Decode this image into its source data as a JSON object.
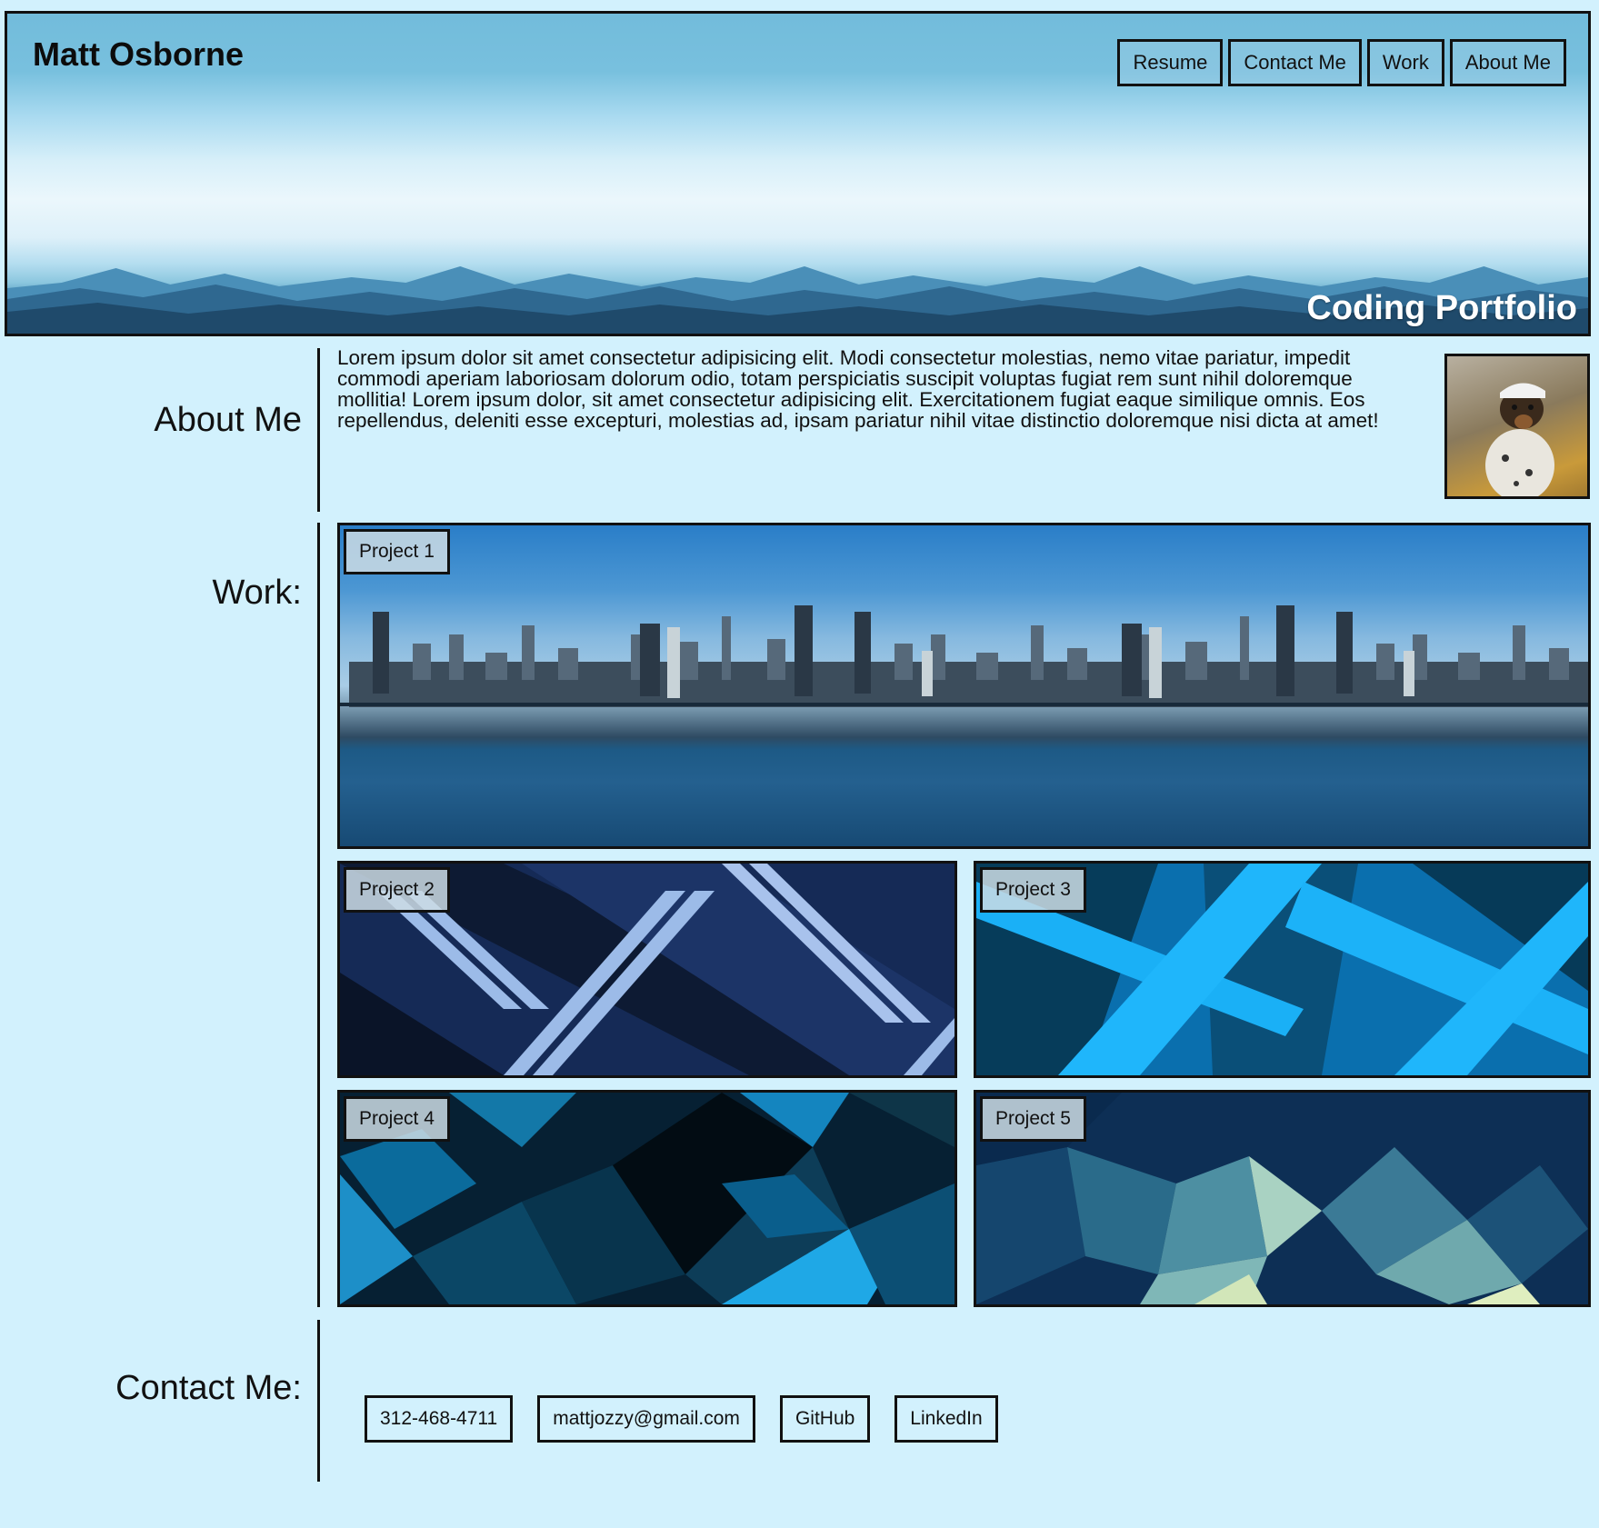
{
  "header": {
    "name": "Matt Osborne",
    "nav": [
      "Resume",
      "Contact Me",
      "Work",
      "About Me"
    ],
    "tagline": "Coding Portfolio"
  },
  "about": {
    "heading": "About Me",
    "text": "Lorem ipsum dolor sit amet consectetur adipisicing elit. Modi consectetur molestias, nemo vitae pariatur, impedit commodi aperiam laboriosam dolorum odio, totam perspiciatis suscipit voluptas fugiat rem sunt nihil doloremque mollitia! Lorem ipsum dolor, sit amet consectetur adipisicing elit. Exercitationem fugiat eaque similique omnis. Eos repellendus, deleniti esse excepturi, molestias ad, ipsam pariatur nihil vitae distinctio doloremque nisi dicta at amet!"
  },
  "work": {
    "heading": "Work:",
    "projects": [
      "Project 1",
      "Project 2",
      "Project 3",
      "Project 4",
      "Project 5"
    ]
  },
  "contact": {
    "heading": "Contact Me:",
    "items": [
      "312-468-4711",
      "mattjozzy@gmail.com",
      "GitHub",
      "LinkedIn"
    ]
  },
  "colors": {
    "page_bg": "#d2f1fd",
    "border": "#111111",
    "tagline": "#ffffff"
  }
}
